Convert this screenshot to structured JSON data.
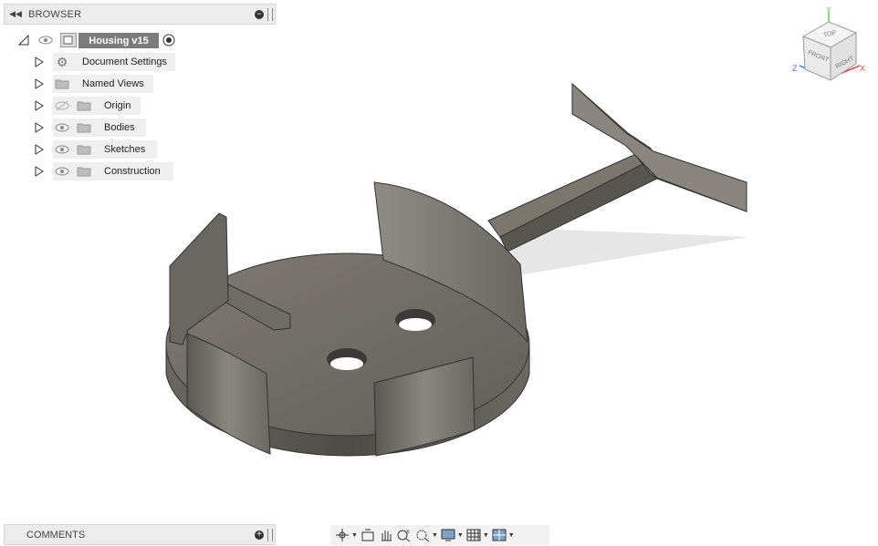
{
  "browser": {
    "title": "BROWSER",
    "root": {
      "label": "Housing v15"
    },
    "items": [
      {
        "label": "Document Settings",
        "icon": "gear-icon",
        "visible": null
      },
      {
        "label": "Named Views",
        "icon": "folder-icon",
        "visible": null
      },
      {
        "label": "Origin",
        "icon": "folder-icon",
        "visible": false
      },
      {
        "label": "Bodies",
        "icon": "folder-icon",
        "visible": true
      },
      {
        "label": "Sketches",
        "icon": "folder-icon",
        "visible": true
      },
      {
        "label": "Construction",
        "icon": "folder-icon",
        "visible": true
      }
    ]
  },
  "comments": {
    "title": "COMMENTS"
  },
  "viewcube": {
    "top": "TOP",
    "front": "FRONT",
    "right": "RIGHT",
    "x": "X",
    "y": "Y",
    "z": "Z"
  },
  "colors": {
    "model_body": "#5f5c57",
    "model_highlight": "#8f8b84",
    "axis_x": "#e14b4b",
    "axis_y": "#5fd35f",
    "axis_z": "#4b6fe1"
  },
  "navbar": {
    "tools": [
      "orbit-icon",
      "look-at-icon",
      "pan-icon",
      "zoom-icon",
      "fit-icon",
      "display-settings-icon",
      "grid-settings-icon",
      "viewports-icon"
    ]
  }
}
